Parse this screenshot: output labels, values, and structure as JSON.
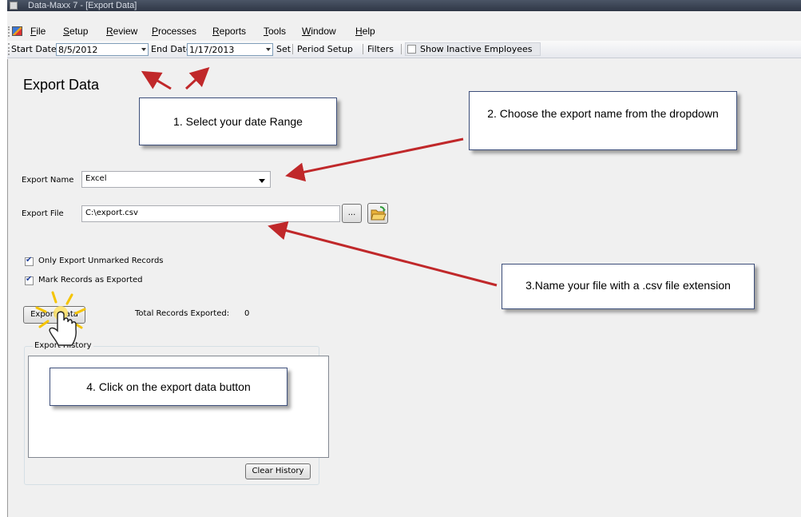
{
  "window": {
    "title": "Data-Maxx 7 - [Export Data]"
  },
  "menu": {
    "items": [
      "File",
      "Setup",
      "Review",
      "Processes",
      "Reports",
      "Tools",
      "Window",
      "Help"
    ]
  },
  "toolbar": {
    "start_date_label": "Start Date",
    "start_date_value": "8/5/2012",
    "end_date_label": "End Date",
    "end_date_value": "1/17/2013",
    "set_label": "Set",
    "period_setup_label": "Period Setup",
    "filters_label": "Filters",
    "show_inactive_label": "Show Inactive Employees",
    "show_inactive_checked": false
  },
  "page": {
    "title": "Export Data",
    "export_name_label": "Export Name",
    "export_name_value": "Excel",
    "export_file_label": "Export File",
    "export_file_value": "C:\\export.csv",
    "browse_label": "...",
    "only_unmarked_label": "Only Export Unmarked Records",
    "only_unmarked_checked": true,
    "mark_exported_label": "Mark Records as Exported",
    "mark_exported_checked": true,
    "export_button_label": "Export Data",
    "total_records_label": "Total Records Exported:",
    "total_records_value": "0",
    "history_group_label": "Export History",
    "clear_history_label": "Clear History"
  },
  "callouts": {
    "step1": "1. Select your date Range",
    "step2": "2. Choose the export name from the dropdown",
    "step3": "3.Name your file with a .csv file extension",
    "step4": "4. Click on the export data button"
  },
  "colors": {
    "arrow": "#c0282a",
    "callout_border": "#3c4e7a",
    "titlebar": "#2f3746"
  },
  "icons": {
    "open_folder": "open-folder-icon",
    "cursor": "hand-pointer-icon"
  }
}
